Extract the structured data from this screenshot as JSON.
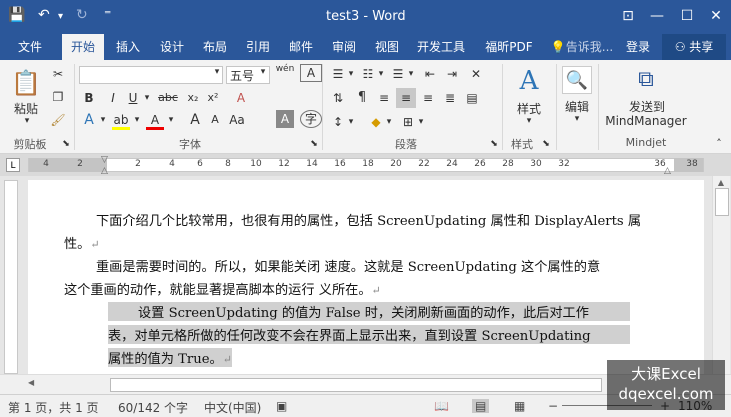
{
  "window": {
    "title": "test3 - Word",
    "quick_access": {
      "save": "💾",
      "undo": "↶",
      "redo": "↻",
      "customize": "⁼"
    },
    "controls": {
      "ribbon_options": "⊡",
      "minimize": "—",
      "maximize": "☐",
      "close": "✕"
    }
  },
  "tabs": [
    "文件",
    "开始",
    "插入",
    "设计",
    "布局",
    "引用",
    "邮件",
    "审阅",
    "视图",
    "开发工具",
    "福昕PDF"
  ],
  "active_tab": "开始",
  "tell_me": "告诉我...",
  "login": "登录",
  "share": "共享",
  "ribbon": {
    "clipboard": {
      "paste": "粘贴",
      "label": "剪贴板"
    },
    "font": {
      "name": "",
      "size": "五号",
      "label": "字体",
      "bold": "B",
      "italic": "I",
      "underline": "U",
      "strike": "abc",
      "subscript": "x₂",
      "superscript": "x²",
      "grow": "A",
      "shrink": "A",
      "case": "Aa",
      "clear": "A",
      "phonetic": "wén",
      "border_char": "A"
    },
    "paragraph": {
      "label": "段落"
    },
    "styles": {
      "label": "样式",
      "button": "样式"
    },
    "editing": {
      "button": "编辑"
    },
    "mindjet": {
      "button_line1": "发送到",
      "button_line2": "MindManager",
      "label": "Mindjet"
    }
  },
  "ruler": {
    "numbers": [
      "4",
      "2",
      "",
      "2",
      "4",
      "6",
      "8",
      "10",
      "12",
      "14",
      "16",
      "18",
      "20",
      "22",
      "24",
      "26",
      "28",
      "30",
      "32",
      "",
      "36",
      "38"
    ]
  },
  "document": {
    "lines": [
      "下面介绍几个比较常用，也很有用的属性，包括 ScreenUpdating 属性和 DisplayAlerts 属",
      "性。",
      "重画是需要时间的。所以，如果能关闭        速度。这就是 ScreenUpdating 这个属性的意",
      "这个重画的动作，就能显著提高脚本的运行        义所在。",
      "设置 ScreenUpdating 的值为 False 时，关闭刷新画面的动作，此后对工作",
      "表，对单元格所做的任何改变不会在界面上显示出来，直到设置 ScreenUpdating",
      "属性的值为 True。"
    ],
    "para_mark": "↵"
  },
  "status": {
    "page": "第 1 页，共 1 页",
    "words": "60/142 个字",
    "language": "中文(中国)",
    "zoom": "110%"
  },
  "watermark": {
    "line1": "大课Excel",
    "line2": "dqexcel.com"
  }
}
